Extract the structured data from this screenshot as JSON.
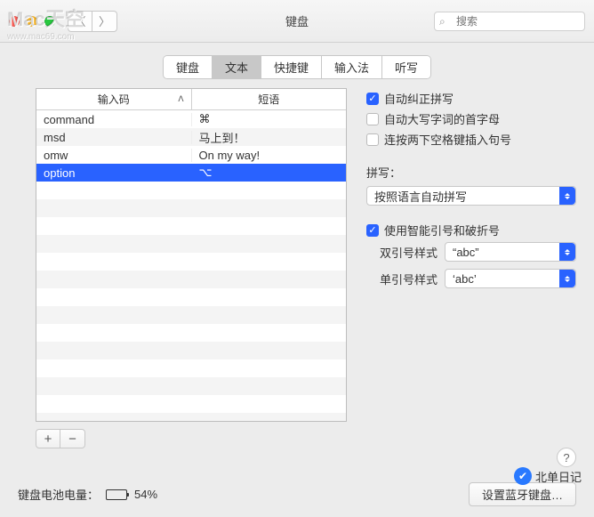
{
  "window": {
    "title": "键盘"
  },
  "search": {
    "placeholder": "搜索"
  },
  "watermark": {
    "line1": "Mac天空",
    "line2": "www.mac69.com"
  },
  "tabs": [
    "键盘",
    "文本",
    "快捷键",
    "输入法",
    "听写"
  ],
  "active_tab": 1,
  "table": {
    "headers": {
      "col1": "输入码",
      "col2": "短语",
      "sort_asc": true
    },
    "rows": [
      {
        "input": "command",
        "phrase": "⌘",
        "selected": false
      },
      {
        "input": "msd",
        "phrase": "马上到！",
        "selected": false
      },
      {
        "input": "omw",
        "phrase": "On my way!",
        "selected": false
      },
      {
        "input": "option",
        "phrase": "⌥",
        "selected": true
      }
    ]
  },
  "options": {
    "autocorrect": {
      "label": "自动纠正拼写",
      "checked": true
    },
    "capitalize": {
      "label": "自动大写字词的首字母",
      "checked": false
    },
    "doublespace": {
      "label": "连按两下空格键插入句号",
      "checked": false
    },
    "spelling_label": "拼写：",
    "spelling_value": "按照语言自动拼写",
    "smartquotes": {
      "label": "使用智能引号和破折号",
      "checked": true
    },
    "double_quote_label": "双引号样式",
    "double_quote_value": "“abc”",
    "single_quote_label": "单引号样式",
    "single_quote_value": "‘abc’"
  },
  "footer": {
    "battery_label": "键盘电池电量：",
    "battery_pct": "54%",
    "bt_button": "设置蓝牙键盘…"
  },
  "corner": {
    "text": "北单日记"
  }
}
